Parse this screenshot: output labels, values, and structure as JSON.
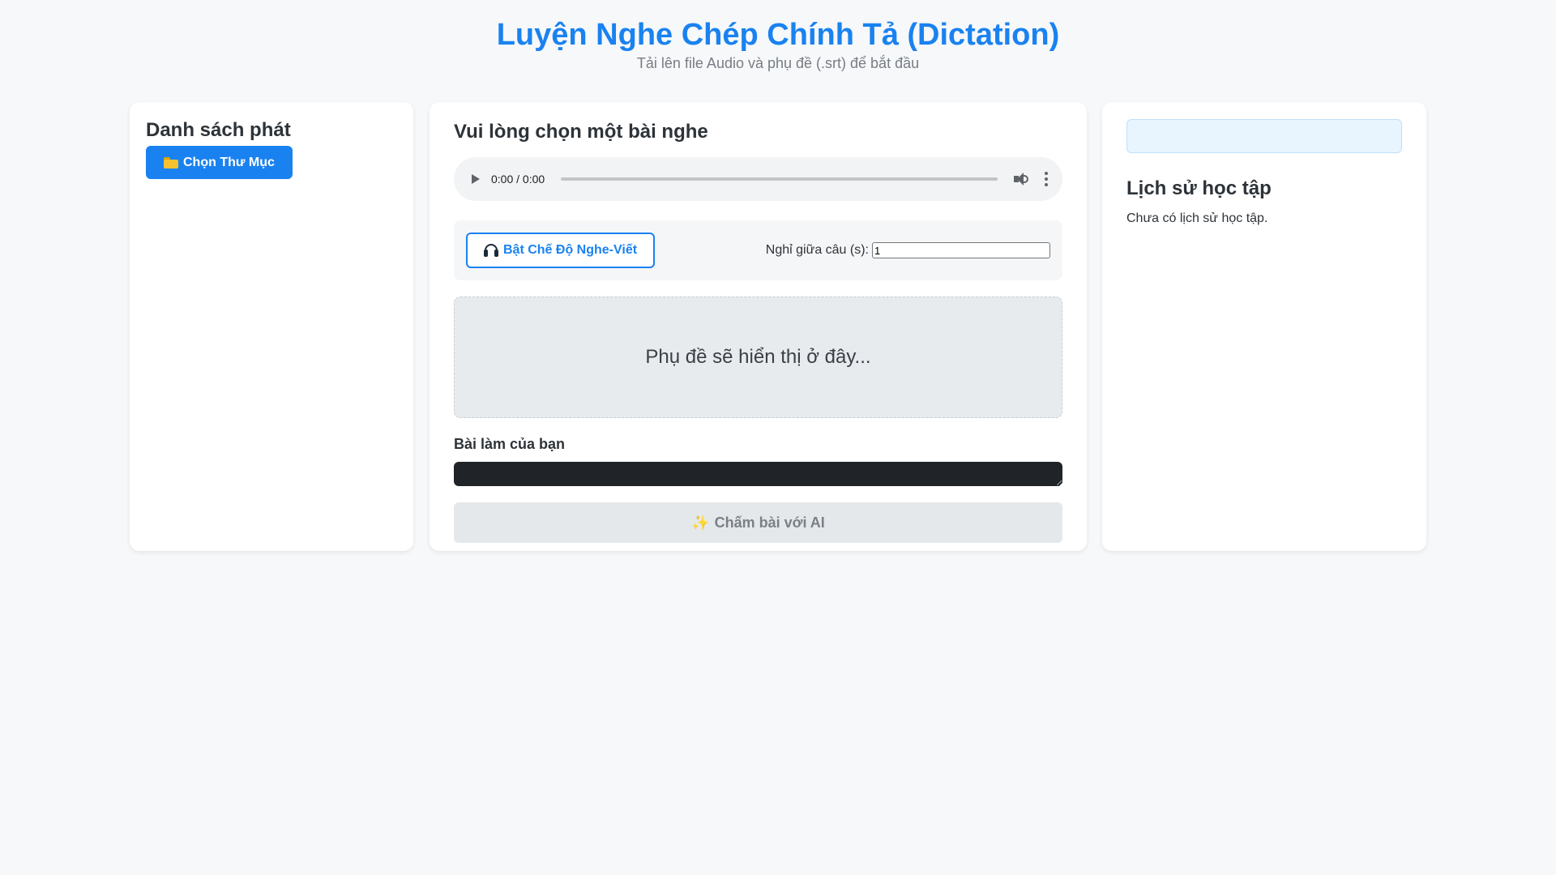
{
  "header": {
    "title": "Luyện Nghe Chép Chính Tả (Dictation)",
    "subtitle": "Tải lên file Audio và phụ đề (.srt) để bắt đầu"
  },
  "playlist": {
    "heading": "Danh sách phát",
    "choose_folder_label": "Chọn Thư Mục",
    "icon": "folder-icon"
  },
  "lesson": {
    "heading": "Vui lòng chọn một bài nghe",
    "audio": {
      "time": "0:00 / 0:00",
      "progress": 0
    },
    "mode_button_label": "Bật Chế Độ Nghe-Viết",
    "mode_button_icon": "headphones-icon",
    "pause_label": "Nghỉ giữa câu (s):",
    "pause_value": "1",
    "subtitle_placeholder": "Phụ đề sẽ hiển thị ở đây...",
    "work_label": "Bài làm của bạn",
    "grade_button_label": "Chấm bài với AI",
    "grade_button_icon": "sparkle-icon"
  },
  "history": {
    "heading": "Lịch sử học tập",
    "empty_text": "Chưa có lịch sử học tập."
  },
  "colors": {
    "accent": "#1a82f0",
    "background": "#f7f8fa"
  }
}
